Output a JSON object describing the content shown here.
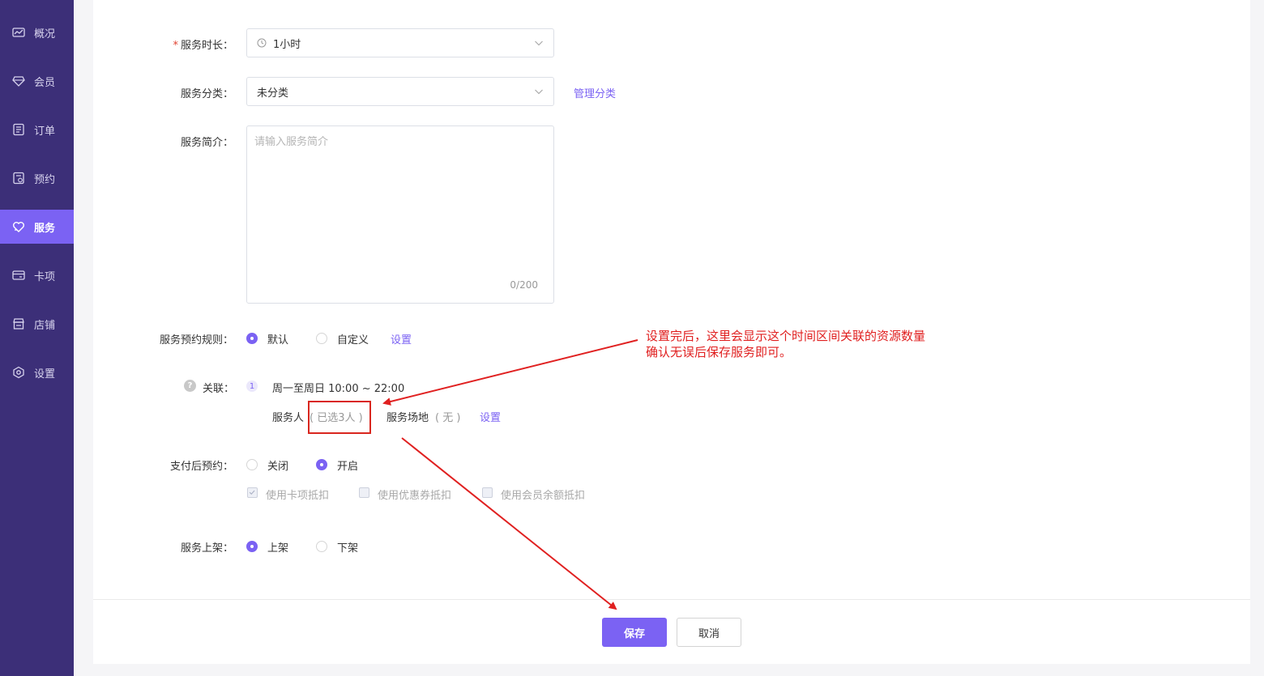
{
  "sidebar": {
    "items": [
      {
        "label": "概况",
        "icon": "overview-chart-icon"
      },
      {
        "label": "会员",
        "icon": "diamond-icon"
      },
      {
        "label": "订单",
        "icon": "order-list-icon"
      },
      {
        "label": "预约",
        "icon": "booking-icon"
      },
      {
        "label": "服务",
        "icon": "service-heart-icon"
      },
      {
        "label": "卡项",
        "icon": "card-icon"
      },
      {
        "label": "店铺",
        "icon": "store-icon"
      },
      {
        "label": "设置",
        "icon": "settings-icon"
      }
    ],
    "active": "服务",
    "active_color": "#7b62f3",
    "bg_color": "#3c2f78"
  },
  "form": {
    "duration": {
      "required_mark": "*",
      "label": "服务时长：",
      "value": "1小时"
    },
    "category": {
      "label": "服务分类：",
      "value": "未分类",
      "manage_link": "管理分类"
    },
    "intro": {
      "label": "服务简介：",
      "placeholder": "请输入服务简介",
      "counter": "0/200"
    },
    "booking_rule": {
      "label": "服务预约规则：",
      "options": [
        "默认",
        "自定义"
      ],
      "selected": "默认",
      "settings_link": "设置"
    },
    "relation": {
      "help_icon": "?",
      "label": "关联：",
      "index": "1",
      "schedule": "周一至周日 10:00 ~ 22:00",
      "staff_label": "服务人",
      "staff_value": "( 已选3人 )",
      "venue_label": "服务场地",
      "venue_value": "( 无 )",
      "settings_link": "设置"
    },
    "pay_then_book": {
      "label": "支付后预约：",
      "options": [
        "关闭",
        "开启"
      ],
      "selected": "开启",
      "checkboxes": [
        {
          "label": "使用卡项抵扣",
          "checked": true
        },
        {
          "label": "使用优惠券抵扣",
          "checked": false
        },
        {
          "label": "使用会员余额抵扣",
          "checked": false
        }
      ]
    },
    "listing": {
      "label": "服务上架：",
      "options": [
        "上架",
        "下架"
      ],
      "selected": "上架"
    }
  },
  "footer": {
    "save_label": "保存",
    "cancel_label": "取消"
  },
  "annotation": {
    "line1": "设置完后，这里会显示这个时间区间关联的资源数量",
    "line2": "确认无误后保存服务即可。",
    "color": "#e02020"
  }
}
